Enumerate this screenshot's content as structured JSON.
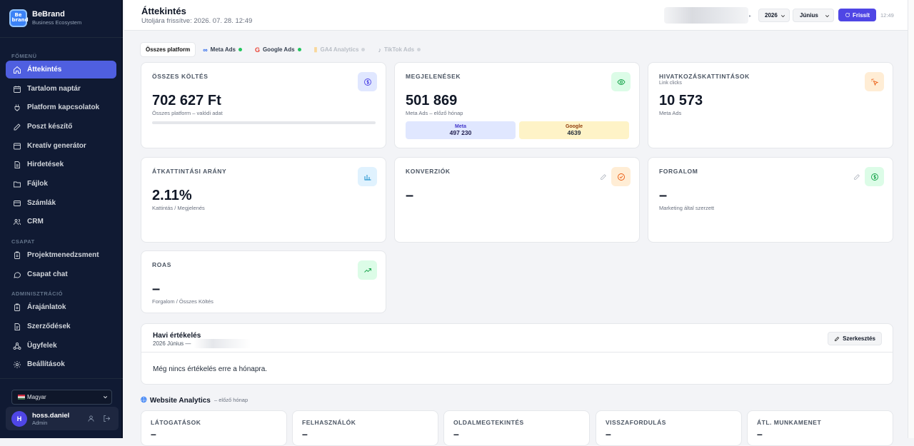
{
  "brand": {
    "logo": "Be brand",
    "name": "BeBrand",
    "tagline": "Business Ecosystem"
  },
  "sidebar": {
    "sections": [
      "FŐMENÜ",
      "CSAPAT",
      "ADMINISZTRÁCIÓ"
    ],
    "items": [
      {
        "label": "Áttekintés",
        "icon": "home-icon",
        "active": true
      },
      {
        "label": "Tartalom naptár",
        "icon": "calendar-icon"
      },
      {
        "label": "Platform kapcsolatok",
        "icon": "plug-icon"
      },
      {
        "label": "Poszt készítő",
        "icon": "edit-icon"
      },
      {
        "label": "Kreatív generátor",
        "icon": "layout-icon"
      },
      {
        "label": "Hirdetések",
        "icon": "file-icon"
      },
      {
        "label": "Fájlok",
        "icon": "folder-icon"
      },
      {
        "label": "Számlák",
        "icon": "receipt-icon"
      },
      {
        "label": "CRM",
        "icon": "users-icon"
      },
      {
        "label": "Projektmenedzsment",
        "icon": "clipboard-icon"
      },
      {
        "label": "Csapat chat",
        "icon": "chat-icon"
      },
      {
        "label": "Árajánlatok",
        "icon": "clipboard-icon"
      },
      {
        "label": "Szerződések",
        "icon": "document-icon"
      },
      {
        "label": "Ügyfelek",
        "icon": "network-icon"
      },
      {
        "label": "Beállítások",
        "icon": "gear-icon"
      }
    ],
    "language": "Magyar",
    "user": {
      "initial": "H",
      "name": "hoss.daniel",
      "role": "Admin"
    }
  },
  "header": {
    "title": "Áttekintés",
    "subtitle": "Utoljára frissítve: 2026. 07. 28. 12:49",
    "year": "2026",
    "month": "Június",
    "refresh_label": "Frissít",
    "time": "12:49"
  },
  "platform_tabs": [
    {
      "label": "Összes platform",
      "active": true
    },
    {
      "label": "Meta Ads",
      "status": "#22c55e"
    },
    {
      "label": "Google Ads",
      "status": "#22c55e"
    },
    {
      "label": "GA4 Analytics",
      "status": "#d1d5db",
      "disabled": true
    },
    {
      "label": "TikTok Ads",
      "status": "#d1d5db",
      "disabled": true
    }
  ],
  "cards": {
    "spend": {
      "label": "ÖSSZES KÖLTÉS",
      "value": "702 627 Ft",
      "note": "Összes platform – valódi adat"
    },
    "impressions": {
      "label": "MEGJELENÉSEK",
      "value": "501 869",
      "note": "Meta Ads – előző hónap",
      "meta_label": "Meta",
      "meta_value": "497 230",
      "google_label": "Google",
      "google_value": "4639"
    },
    "clicks": {
      "label": "HIVATKOZÁSKATTINTÁSOK",
      "sublabel": "Link clicks",
      "value": "10 573",
      "note": "Meta Ads"
    },
    "ctr": {
      "label": "ÁTKATTINTÁSI ARÁNY",
      "value": "2.11%",
      "note": "Kattintás / Megjelenés"
    },
    "conversions": {
      "label": "KONVERZIÓK",
      "value": "–"
    },
    "revenue": {
      "label": "FORGALOM",
      "value": "–",
      "note": "Marketing által szerzett"
    },
    "roas": {
      "label": "ROAS",
      "value": "–",
      "note": "Forgalom / Összes Költés"
    }
  },
  "review": {
    "title": "Havi értékelés",
    "subtitle": "2026 Június —",
    "edit_label": "Szerkesztés",
    "empty": "Még nincs értékelés erre a hónapra."
  },
  "website": {
    "title": "Website Analytics",
    "subtitle": "– előző hónap",
    "metrics": [
      {
        "label": "LÁTOGATÁSOK",
        "value": "–"
      },
      {
        "label": "FELHASZNÁLÓK",
        "value": "–"
      },
      {
        "label": "OLDALMEGTEKINTÉS",
        "value": "–"
      },
      {
        "label": "VISSZAFORDULÁS",
        "value": "–"
      },
      {
        "label": "ÁTL. MUNKAMENET",
        "value": "–"
      }
    ]
  }
}
